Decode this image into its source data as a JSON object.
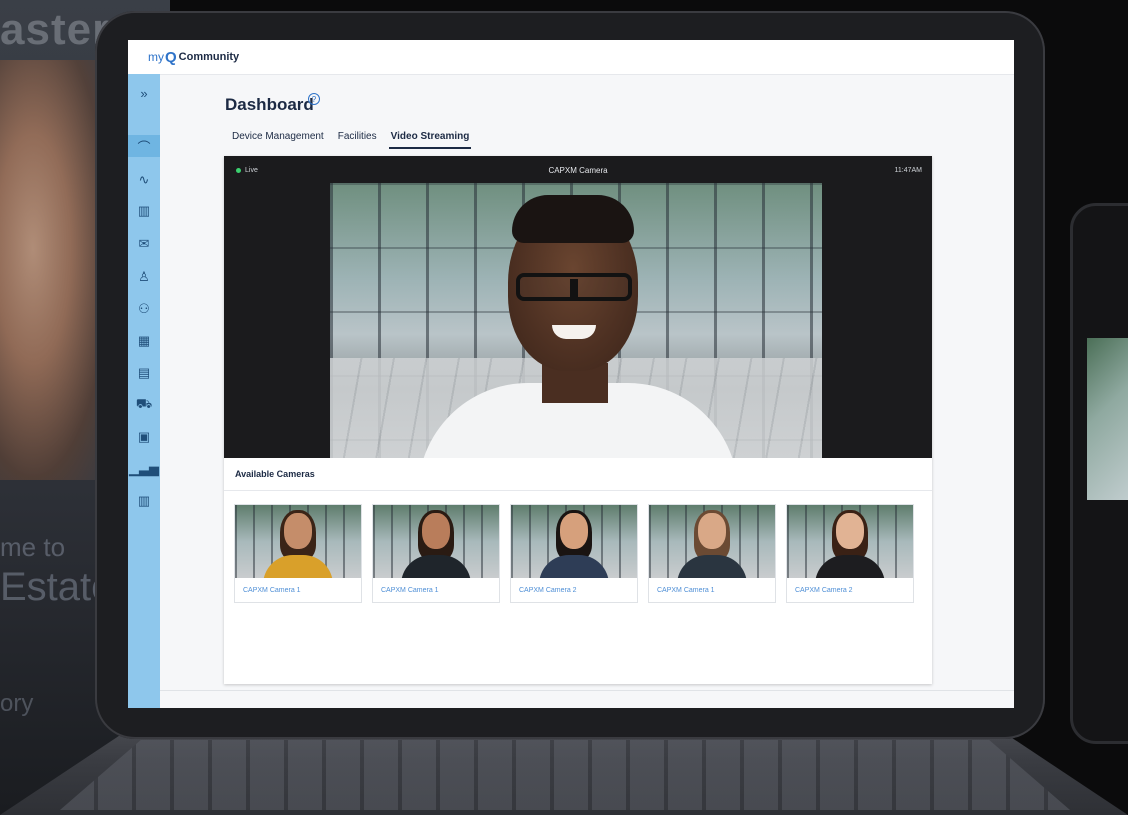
{
  "background": {
    "poster_heading": "aster",
    "poster_line1": "me to",
    "poster_line2": "Estate",
    "poster_line3": "ory"
  },
  "app": {
    "logo_my": "my",
    "logo_q": "Q",
    "logo_name": "Community"
  },
  "sidebar": {
    "expand": "»",
    "items": [
      {
        "icon": "dashboard-gauge-icon",
        "glyph": "⌒"
      },
      {
        "icon": "activity-icon",
        "glyph": "∿"
      },
      {
        "icon": "building-icon",
        "glyph": "▥"
      },
      {
        "icon": "mail-icon",
        "glyph": "✉"
      },
      {
        "icon": "user-icon",
        "glyph": "♙"
      },
      {
        "icon": "users-icon",
        "glyph": "⚇"
      },
      {
        "icon": "calendar-icon",
        "glyph": "▦"
      },
      {
        "icon": "id-card-icon",
        "glyph": "▤"
      },
      {
        "icon": "parking-icon",
        "glyph": "⛟"
      },
      {
        "icon": "badge-icon",
        "glyph": "▣"
      },
      {
        "icon": "bar-chart-icon",
        "glyph": "▁▃▅"
      },
      {
        "icon": "buildings-icon",
        "glyph": "▥"
      }
    ]
  },
  "page": {
    "title": "Dashboard",
    "help": "?"
  },
  "tabs": [
    {
      "label": "Device Management",
      "active": false
    },
    {
      "label": "Facilities",
      "active": false
    },
    {
      "label": "Video Streaming",
      "active": true
    }
  ],
  "video": {
    "status": "Live",
    "camera_title": "CAPXM Camera",
    "time": "11:47AM"
  },
  "cameras": {
    "heading": "Available Cameras",
    "items": [
      {
        "label": "CAPXM Camera 1",
        "skin": "#c58d6a",
        "hair": "#3b2417",
        "shirt": "#d9a02a"
      },
      {
        "label": "CAPXM Camera 1",
        "skin": "#b97d5b",
        "hair": "#2a1b13",
        "shirt": "#1f252b"
      },
      {
        "label": "CAPXM Camera 2",
        "skin": "#d6a07c",
        "hair": "#1a1412",
        "shirt": "#2e3d56"
      },
      {
        "label": "CAPXM Camera 1",
        "skin": "#d9a887",
        "hair": "#6b4a33",
        "shirt": "#2a3540"
      },
      {
        "label": "CAPXM Camera 2",
        "skin": "#e1b394",
        "hair": "#3a2115",
        "shirt": "#1d1d20"
      }
    ]
  },
  "colors": {
    "sidebar": "#8ec7ec",
    "accent": "#2e73c9",
    "live": "#3bd16f"
  }
}
